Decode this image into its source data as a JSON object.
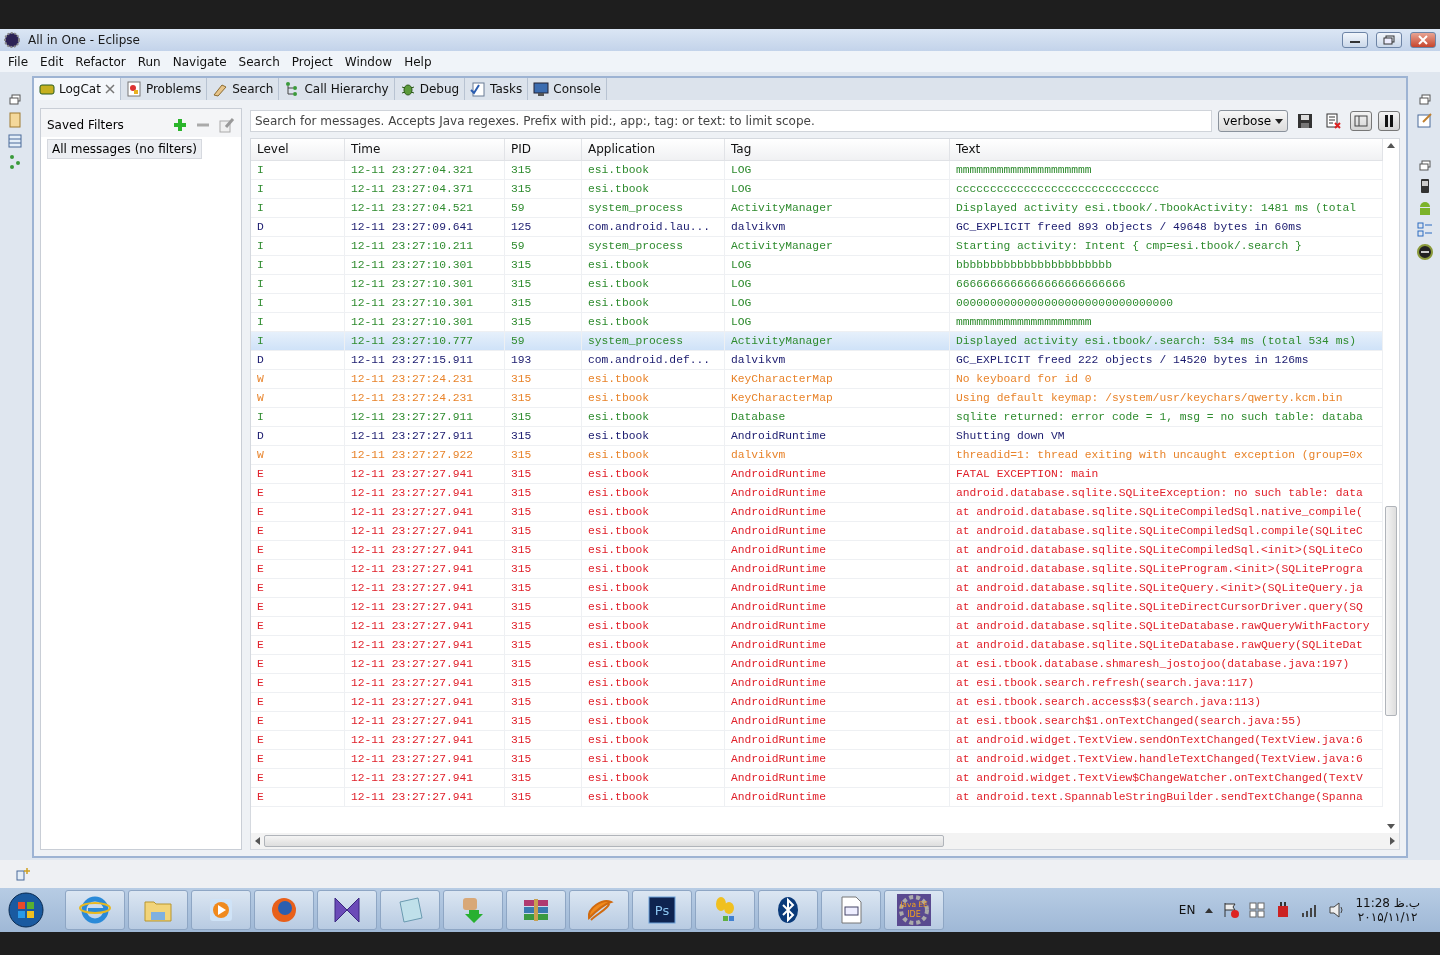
{
  "window": {
    "title": "All in One - Eclipse"
  },
  "menu": [
    "File",
    "Edit",
    "Refactor",
    "Run",
    "Navigate",
    "Search",
    "Project",
    "Window",
    "Help"
  ],
  "tabs": [
    {
      "label": "LogCat",
      "kind": "logcat",
      "selected": true,
      "closable": true
    },
    {
      "label": "Problems",
      "kind": "problems",
      "selected": false,
      "closable": false
    },
    {
      "label": "Search",
      "kind": "search",
      "selected": false,
      "closable": false
    },
    {
      "label": "Call Hierarchy",
      "kind": "hierarchy",
      "selected": false,
      "closable": false
    },
    {
      "label": "Debug",
      "kind": "debug",
      "selected": false,
      "closable": false
    },
    {
      "label": "Tasks",
      "kind": "tasks",
      "selected": false,
      "closable": false
    },
    {
      "label": "Console",
      "kind": "console",
      "selected": false,
      "closable": false
    }
  ],
  "filters": {
    "title": "Saved Filters",
    "items": [
      {
        "label": "All messages (no filters)",
        "selected": true
      }
    ]
  },
  "search": {
    "placeholder": "Search for messages. Accepts Java regexes. Prefix with pid:, app:, tag: or text: to limit scope."
  },
  "level_select": {
    "value": "verbose"
  },
  "table": {
    "columns": [
      "Level",
      "Time",
      "PID",
      "Application",
      "Tag",
      "Text"
    ],
    "rows": [
      {
        "level": "I",
        "time": "12-11 23:27:04.321",
        "pid": "315",
        "application": "esi.tbook",
        "tag": "LOG",
        "text": "mmmmmmmmmmmmmmmmmmmm",
        "color": "#2e8b2e",
        "selected": false
      },
      {
        "level": "I",
        "time": "12-11 23:27:04.371",
        "pid": "315",
        "application": "esi.tbook",
        "tag": "LOG",
        "text": "cccccccccccccccccccccccccccccc",
        "color": "#2e8b2e",
        "selected": false
      },
      {
        "level": "I",
        "time": "12-11 23:27:04.521",
        "pid": "59",
        "application": "system_process",
        "tag": "ActivityManager",
        "text": "Displayed activity esi.tbook/.TbookActivity: 1481 ms (total",
        "color": "#2e8b2e",
        "selected": false
      },
      {
        "level": "D",
        "time": "12-11 23:27:09.641",
        "pid": "125",
        "application": "com.android.lau...",
        "tag": "dalvikvm",
        "text": "GC_EXPLICIT freed 893 objects / 49648 bytes in 60ms",
        "color": "#1a1a6e",
        "selected": false
      },
      {
        "level": "I",
        "time": "12-11 23:27:10.211",
        "pid": "59",
        "application": "system_process",
        "tag": "ActivityManager",
        "text": "Starting activity: Intent { cmp=esi.tbook/.search }",
        "color": "#2e8b2e",
        "selected": false
      },
      {
        "level": "I",
        "time": "12-11 23:27:10.301",
        "pid": "315",
        "application": "esi.tbook",
        "tag": "LOG",
        "text": "bbbbbbbbbbbbbbbbbbbbbbb",
        "color": "#2e8b2e",
        "selected": false
      },
      {
        "level": "I",
        "time": "12-11 23:27:10.301",
        "pid": "315",
        "application": "esi.tbook",
        "tag": "LOG",
        "text": "6666666666666666666666666",
        "color": "#2e8b2e",
        "selected": false
      },
      {
        "level": "I",
        "time": "12-11 23:27:10.301",
        "pid": "315",
        "application": "esi.tbook",
        "tag": "LOG",
        "text": "00000000000000000000000000000000",
        "color": "#2e8b2e",
        "selected": false
      },
      {
        "level": "I",
        "time": "12-11 23:27:10.301",
        "pid": "315",
        "application": "esi.tbook",
        "tag": "LOG",
        "text": "mmmmmmmmmmmmmmmmmmmm",
        "color": "#2e8b2e",
        "selected": false
      },
      {
        "level": "I",
        "time": "12-11 23:27:10.777",
        "pid": "59",
        "application": "system_process",
        "tag": "ActivityManager",
        "text": "Displayed activity esi.tbook/.search: 534 ms (total 534 ms)",
        "color": "#2e8b2e",
        "selected": true
      },
      {
        "level": "D",
        "time": "12-11 23:27:15.911",
        "pid": "193",
        "application": "com.android.def...",
        "tag": "dalvikvm",
        "text": "GC_EXPLICIT freed 222 objects / 14520 bytes in 126ms",
        "color": "#1a1a6e",
        "selected": false
      },
      {
        "level": "W",
        "time": "12-11 23:27:24.231",
        "pid": "315",
        "application": "esi.tbook",
        "tag": "KeyCharacterMap",
        "text": "No keyboard for id 0",
        "color": "#e8832a",
        "selected": false
      },
      {
        "level": "W",
        "time": "12-11 23:27:24.231",
        "pid": "315",
        "application": "esi.tbook",
        "tag": "KeyCharacterMap",
        "text": "Using default keymap: /system/usr/keychars/qwerty.kcm.bin",
        "color": "#e8832a",
        "selected": false
      },
      {
        "level": "I",
        "time": "12-11 23:27:27.911",
        "pid": "315",
        "application": "esi.tbook",
        "tag": "Database",
        "text": "sqlite returned: error code = 1, msg = no such table: databa",
        "color": "#2e8b2e",
        "selected": false
      },
      {
        "level": "D",
        "time": "12-11 23:27:27.911",
        "pid": "315",
        "application": "esi.tbook",
        "tag": "AndroidRuntime",
        "text": "Shutting down VM",
        "color": "#1a1a6e",
        "selected": false
      },
      {
        "level": "W",
        "time": "12-11 23:27:27.922",
        "pid": "315",
        "application": "esi.tbook",
        "tag": "dalvikvm",
        "text": "threadid=1: thread exiting with uncaught exception (group=0x",
        "color": "#e8832a",
        "selected": false
      },
      {
        "level": "E",
        "time": "12-11 23:27:27.941",
        "pid": "315",
        "application": "esi.tbook",
        "tag": "AndroidRuntime",
        "text": "FATAL EXCEPTION: main",
        "color": "#e0202a",
        "selected": false
      },
      {
        "level": "E",
        "time": "12-11 23:27:27.941",
        "pid": "315",
        "application": "esi.tbook",
        "tag": "AndroidRuntime",
        "text": "android.database.sqlite.SQLiteException: no such table: data",
        "color": "#e0202a",
        "selected": false
      },
      {
        "level": "E",
        "time": "12-11 23:27:27.941",
        "pid": "315",
        "application": "esi.tbook",
        "tag": "AndroidRuntime",
        "text": "at android.database.sqlite.SQLiteCompiledSql.native_compile(",
        "color": "#e0202a",
        "selected": false
      },
      {
        "level": "E",
        "time": "12-11 23:27:27.941",
        "pid": "315",
        "application": "esi.tbook",
        "tag": "AndroidRuntime",
        "text": "at android.database.sqlite.SQLiteCompiledSql.compile(SQLiteC",
        "color": "#e0202a",
        "selected": false
      },
      {
        "level": "E",
        "time": "12-11 23:27:27.941",
        "pid": "315",
        "application": "esi.tbook",
        "tag": "AndroidRuntime",
        "text": "at android.database.sqlite.SQLiteCompiledSql.<init>(SQLiteCo",
        "color": "#e0202a",
        "selected": false
      },
      {
        "level": "E",
        "time": "12-11 23:27:27.941",
        "pid": "315",
        "application": "esi.tbook",
        "tag": "AndroidRuntime",
        "text": "at android.database.sqlite.SQLiteProgram.<init>(SQLiteProgra",
        "color": "#e0202a",
        "selected": false
      },
      {
        "level": "E",
        "time": "12-11 23:27:27.941",
        "pid": "315",
        "application": "esi.tbook",
        "tag": "AndroidRuntime",
        "text": "at android.database.sqlite.SQLiteQuery.<init>(SQLiteQuery.ja",
        "color": "#e0202a",
        "selected": false
      },
      {
        "level": "E",
        "time": "12-11 23:27:27.941",
        "pid": "315",
        "application": "esi.tbook",
        "tag": "AndroidRuntime",
        "text": "at android.database.sqlite.SQLiteDirectCursorDriver.query(SQ",
        "color": "#e0202a",
        "selected": false
      },
      {
        "level": "E",
        "time": "12-11 23:27:27.941",
        "pid": "315",
        "application": "esi.tbook",
        "tag": "AndroidRuntime",
        "text": "at android.database.sqlite.SQLiteDatabase.rawQueryWithFactory",
        "color": "#e0202a",
        "selected": false
      },
      {
        "level": "E",
        "time": "12-11 23:27:27.941",
        "pid": "315",
        "application": "esi.tbook",
        "tag": "AndroidRuntime",
        "text": "at android.database.sqlite.SQLiteDatabase.rawQuery(SQLiteDat",
        "color": "#e0202a",
        "selected": false
      },
      {
        "level": "E",
        "time": "12-11 23:27:27.941",
        "pid": "315",
        "application": "esi.tbook",
        "tag": "AndroidRuntime",
        "text": "at esi.tbook.database.shmaresh_jostojoo(database.java:197)",
        "color": "#e0202a",
        "selected": false
      },
      {
        "level": "E",
        "time": "12-11 23:27:27.941",
        "pid": "315",
        "application": "esi.tbook",
        "tag": "AndroidRuntime",
        "text": "at esi.tbook.search.refresh(search.java:117)",
        "color": "#e0202a",
        "selected": false
      },
      {
        "level": "E",
        "time": "12-11 23:27:27.941",
        "pid": "315",
        "application": "esi.tbook",
        "tag": "AndroidRuntime",
        "text": "at esi.tbook.search.access$3(search.java:113)",
        "color": "#e0202a",
        "selected": false
      },
      {
        "level": "E",
        "time": "12-11 23:27:27.941",
        "pid": "315",
        "application": "esi.tbook",
        "tag": "AndroidRuntime",
        "text": "at esi.tbook.search$1.onTextChanged(search.java:55)",
        "color": "#e0202a",
        "selected": false
      },
      {
        "level": "E",
        "time": "12-11 23:27:27.941",
        "pid": "315",
        "application": "esi.tbook",
        "tag": "AndroidRuntime",
        "text": "at android.widget.TextView.sendOnTextChanged(TextView.java:6",
        "color": "#e0202a",
        "selected": false
      },
      {
        "level": "E",
        "time": "12-11 23:27:27.941",
        "pid": "315",
        "application": "esi.tbook",
        "tag": "AndroidRuntime",
        "text": "at android.widget.TextView.handleTextChanged(TextView.java:6",
        "color": "#e0202a",
        "selected": false
      },
      {
        "level": "E",
        "time": "12-11 23:27:27.941",
        "pid": "315",
        "application": "esi.tbook",
        "tag": "AndroidRuntime",
        "text": "at android.widget.TextView$ChangeWatcher.onTextChanged(TextV",
        "color": "#e0202a",
        "selected": false
      },
      {
        "level": "E",
        "time": "12-11 23:27:27.941",
        "pid": "315",
        "application": "esi.tbook",
        "tag": "AndroidRuntime",
        "text": "at android.text.SpannableStringBuilder.sendTextChange(Spanna",
        "color": "#e0202a",
        "selected": false
      }
    ]
  },
  "taskbar": {
    "apps": [
      {
        "kind": "browser-e"
      },
      {
        "kind": "folder"
      },
      {
        "kind": "player"
      },
      {
        "kind": "firefox"
      },
      {
        "kind": "bowtie"
      },
      {
        "kind": "notepad"
      },
      {
        "kind": "download"
      },
      {
        "kind": "archive"
      },
      {
        "kind": "swirl"
      },
      {
        "kind": "ps",
        "icon_text": "Ps"
      },
      {
        "kind": "leaves"
      },
      {
        "kind": "bluetooth"
      },
      {
        "kind": "document"
      },
      {
        "kind": "gear",
        "icon_text": "Java EE IDE"
      }
    ],
    "language": "EN",
    "time": "11:28 ب.ظ",
    "date": "۲۰۱۵/۱۱/۱۲"
  }
}
